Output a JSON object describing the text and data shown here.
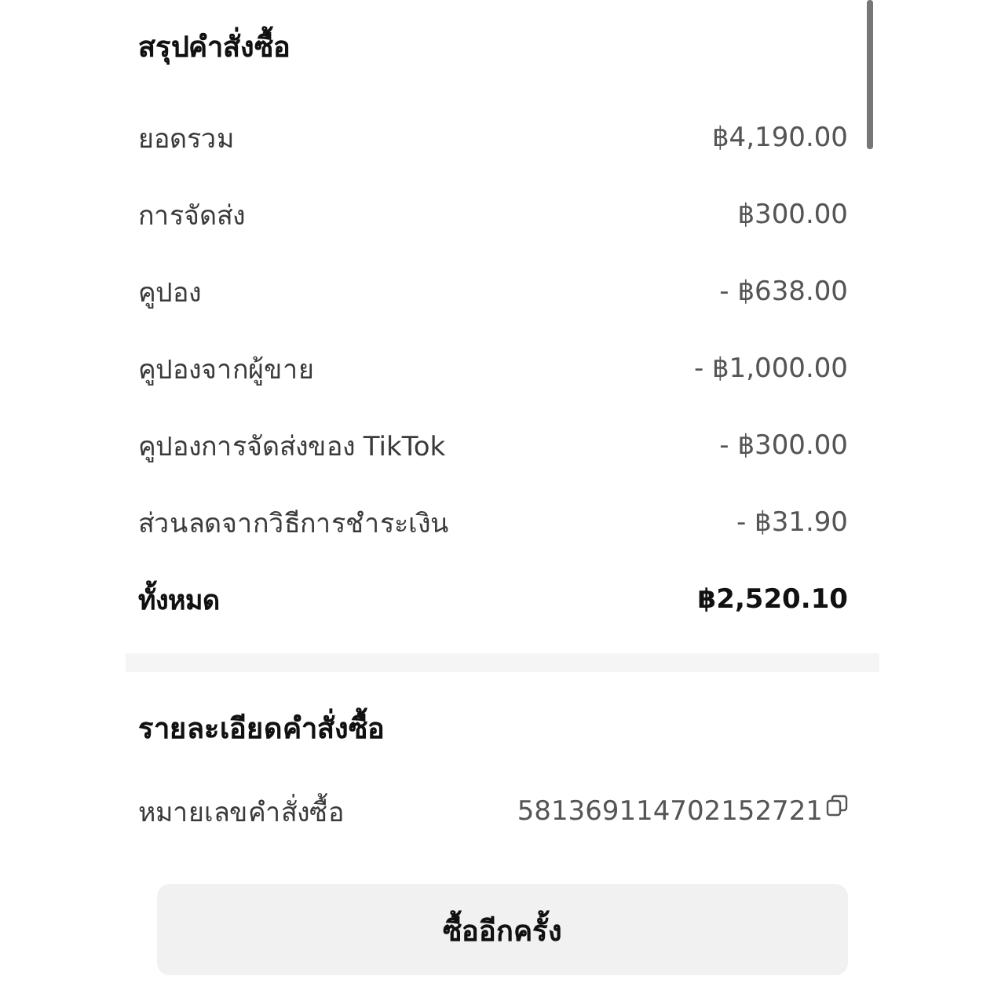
{
  "summary": {
    "title": "สรุปคำสั่งซื้อ",
    "rows": [
      {
        "label": "ยอดรวม",
        "value": "฿4,190.00",
        "kind": "line"
      },
      {
        "label": "การจัดส่ง",
        "value": "฿300.00",
        "kind": "line"
      },
      {
        "label": "คูปอง",
        "value": "- ฿638.00",
        "kind": "line"
      },
      {
        "label": "คูปองจากผู้ขาย",
        "value": "- ฿1,000.00",
        "kind": "line"
      },
      {
        "label": "คูปองการจัดส่งของ TikTok",
        "value": "- ฿300.00",
        "kind": "line"
      },
      {
        "label": "ส่วนลดจากวิธีการชำระเงิน",
        "value": "- ฿31.90",
        "kind": "line"
      },
      {
        "label": "ทั้งหมด",
        "value": "฿2,520.10",
        "kind": "total"
      }
    ]
  },
  "details": {
    "title": "รายละเอียดคำสั่งซื้อ",
    "order_label": "หมายเลขคำสั่งซื้อ",
    "order_number": "581369114702152721"
  },
  "buy_again_button": "ซื้ออีกครั้ง"
}
